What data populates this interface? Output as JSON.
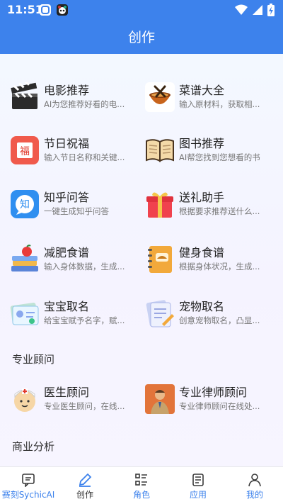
{
  "status_bar": {
    "time": "11:51"
  },
  "header": {
    "title": "创作"
  },
  "cards": [
    {
      "name": "电影推荐",
      "desc": "AI为您推荐好看的电..."
    },
    {
      "name": "菜谱大全",
      "desc": "输入原材料，获取相..."
    },
    {
      "name": "节日祝福",
      "desc": "输入节日名称和关键..."
    },
    {
      "name": "图书推荐",
      "desc": "AI帮您找到您想看的书"
    },
    {
      "name": "知乎问答",
      "desc": "一键生成知乎问答"
    },
    {
      "name": "送礼助手",
      "desc": "根据要求推荐送什么..."
    },
    {
      "name": "减肥食谱",
      "desc": "输入身体数据，生成..."
    },
    {
      "name": "健身食谱",
      "desc": "根据身体状况，生成..."
    },
    {
      "name": "宝宝取名",
      "desc": "给宝宝赋予名字，赋..."
    },
    {
      "name": "宠物取名",
      "desc": "创意宠物取名，凸显..."
    }
  ],
  "sections": {
    "consultant": "专业顾问",
    "business": "商业分析"
  },
  "consultant_cards": [
    {
      "name": "医生顾问",
      "desc": "专业医生顾问，在线..."
    },
    {
      "name": "专业律师顾问",
      "desc": "专业律师顾问在线处..."
    }
  ],
  "icons": {
    "fu_char": "福",
    "zhi_char": "知"
  },
  "tabs": [
    {
      "label": "赛刻SychicAI",
      "icon": "chat-icon"
    },
    {
      "label": "创作",
      "icon": "pen-icon"
    },
    {
      "label": "角色",
      "icon": "list-icon"
    },
    {
      "label": "应用",
      "icon": "doc-icon"
    },
    {
      "label": "我的",
      "icon": "person-icon"
    }
  ],
  "colors": {
    "primary": "#3d82ec",
    "tab_active": "#3d82ec"
  }
}
